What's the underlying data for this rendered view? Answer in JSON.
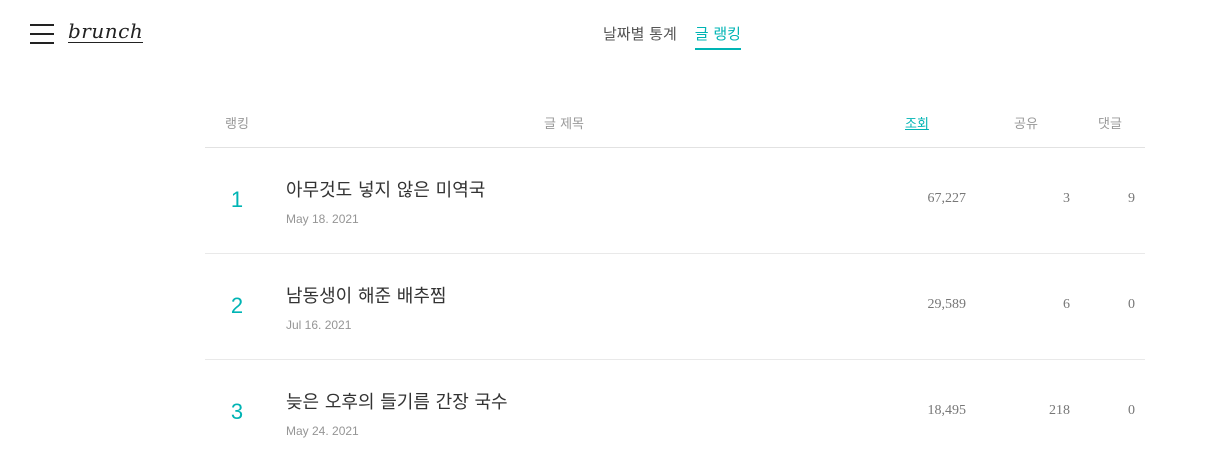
{
  "header": {
    "logo": "brunch",
    "tabs": [
      {
        "label": "날짜별 통계",
        "active": false
      },
      {
        "label": "글 랭킹",
        "active": true
      }
    ]
  },
  "table": {
    "columns": {
      "rank": "랭킹",
      "title": "글 제목",
      "views": "조회",
      "share": "공유",
      "comments": "댓글"
    },
    "sorted_by": "조회",
    "rows": [
      {
        "rank": "1",
        "title": "아무것도 넣지 않은 미역국",
        "date": "May 18. 2021",
        "views": "67,227",
        "share": "3",
        "comments": "9"
      },
      {
        "rank": "2",
        "title": "남동생이 해준 배추찜",
        "date": "Jul 16. 2021",
        "views": "29,589",
        "share": "6",
        "comments": "0"
      },
      {
        "rank": "3",
        "title": "늦은 오후의 들기름 간장 국수",
        "date": "May 24. 2021",
        "views": "18,495",
        "share": "218",
        "comments": "0"
      }
    ]
  },
  "colors": {
    "accent": "#00b4b4"
  }
}
